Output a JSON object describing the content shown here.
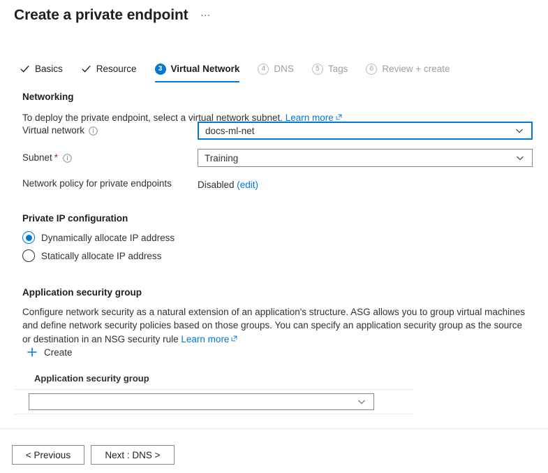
{
  "header": {
    "title": "Create a private endpoint",
    "more_menu": "…"
  },
  "wizard": {
    "tabs": [
      {
        "label": "Basics",
        "state": "done",
        "marker": "check"
      },
      {
        "label": "Resource",
        "state": "done",
        "marker": "check"
      },
      {
        "label": "Virtual Network",
        "state": "active",
        "marker": "3"
      },
      {
        "label": "DNS",
        "state": "upcoming",
        "marker": "4"
      },
      {
        "label": "Tags",
        "state": "upcoming",
        "marker": "5"
      },
      {
        "label": "Review + create",
        "state": "upcoming",
        "marker": "6"
      }
    ]
  },
  "networking": {
    "section_title": "Networking",
    "description": "To deploy the private endpoint, select a virtual network subnet.",
    "learn_more": "Learn more",
    "virtual_network": {
      "label": "Virtual network",
      "value": "docs-ml-net",
      "focused": true
    },
    "subnet": {
      "label": "Subnet",
      "required": true,
      "value": "Training"
    },
    "network_policy": {
      "label": "Network policy for private endpoints",
      "value": "Disabled",
      "edit_link": "(edit)"
    }
  },
  "private_ip": {
    "section_title": "Private IP configuration",
    "options": [
      {
        "label": "Dynamically allocate IP address",
        "selected": true
      },
      {
        "label": "Statically allocate IP address",
        "selected": false
      }
    ]
  },
  "asg": {
    "section_title": "Application security group",
    "description_line1": "Configure network security as a natural extension of an application's structure. ASG allows you to group virtual machines and",
    "description_line2": "define network security policies based on those groups. You can specify an application security group as the source or",
    "description_line3": "destination in an NSG security rule",
    "learn_more": "Learn more",
    "create_label": "Create",
    "column_header": "Application security group",
    "row_value": "",
    "row_placeholder": ""
  },
  "footer": {
    "previous_label": "< Previous",
    "next_label": "Next : DNS >"
  },
  "colors": {
    "accent": "#0078d4",
    "text": "#323130",
    "title": "#201f1e",
    "muted": "#a19f9d",
    "border": "#8a8886",
    "divider": "#edebe9",
    "required": "#a4262c"
  }
}
